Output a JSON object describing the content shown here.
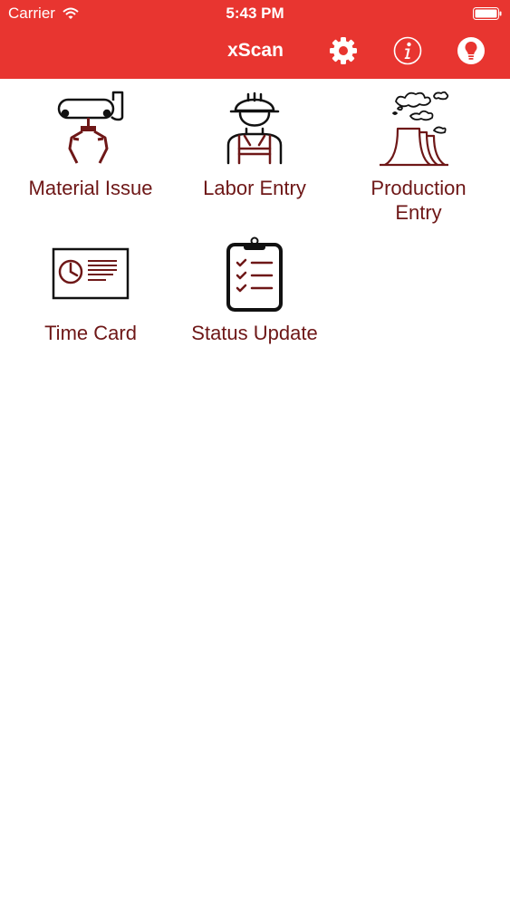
{
  "status_bar": {
    "carrier": "Carrier",
    "time": "5:43 PM"
  },
  "nav": {
    "title": "xScan",
    "icons": [
      "gear-icon",
      "info-icon",
      "lightbulb-icon"
    ]
  },
  "colors": {
    "header_bg": "#E83530",
    "label": "#6E1717",
    "icon_stroke": "#6E1717"
  },
  "menu": {
    "items": [
      {
        "label": "Material Issue",
        "icon": "robot-claw-icon"
      },
      {
        "label": "Labor Entry",
        "icon": "worker-icon"
      },
      {
        "label": "Production\nEntry",
        "icon": "factory-icon"
      },
      {
        "label": "Time Card",
        "icon": "time-card-icon"
      },
      {
        "label": "Status Update",
        "icon": "clipboard-checklist-icon"
      }
    ]
  }
}
